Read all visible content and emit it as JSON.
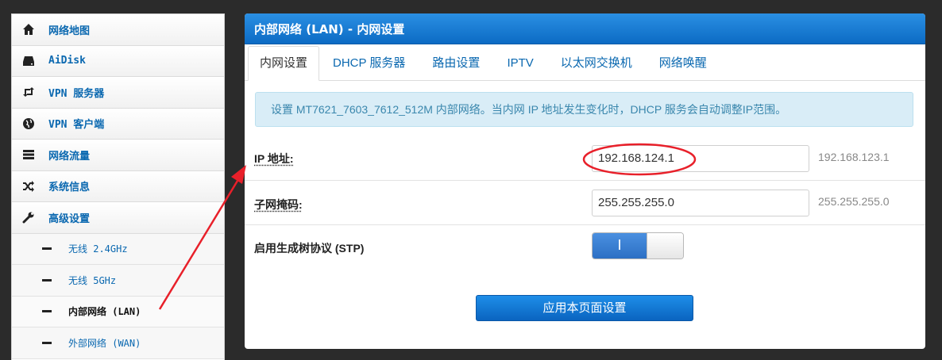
{
  "sidebar": {
    "items": [
      {
        "label": "网络地图",
        "icon": "home-icon"
      },
      {
        "label": "AiDisk",
        "icon": "hdd-icon"
      },
      {
        "label": "VPN 服务器",
        "icon": "retweet-icon"
      },
      {
        "label": "VPN 客户端",
        "icon": "globe-icon"
      },
      {
        "label": "网络流量",
        "icon": "tasks-icon"
      },
      {
        "label": "系统信息",
        "icon": "random-icon"
      },
      {
        "label": "高级设置",
        "icon": "wrench-icon"
      }
    ],
    "subitems": [
      {
        "label": "无线 2.4GHz"
      },
      {
        "label": "无线 5GHz"
      },
      {
        "label": "内部网络 (LAN)"
      },
      {
        "label": "外部网络 (WAN)"
      }
    ]
  },
  "panel": {
    "title": "内部网络 (LAN) - 内网设置",
    "tabs": [
      {
        "label": "内网设置"
      },
      {
        "label": "DHCP 服务器"
      },
      {
        "label": "路由设置"
      },
      {
        "label": "IPTV"
      },
      {
        "label": "以太网交换机"
      },
      {
        "label": "网络唤醒"
      }
    ],
    "info": "设置 MT7621_7603_7612_512M 内部网络。当内网 IP 地址发生变化时，DHCP 服务会自动调整IP范围。",
    "ip": {
      "label": "IP 地址:",
      "value": "192.168.124.1",
      "hint": "192.168.123.1"
    },
    "mask": {
      "label": "子网掩码:",
      "value": "255.255.255.0",
      "hint": "255.255.255.0"
    },
    "stp": {
      "label": "启用生成树协议 (STP)",
      "toggle_text": "I"
    },
    "apply_label": "应用本页面设置"
  },
  "colors": {
    "accent": "#0c6bc4",
    "link": "#0a68b0",
    "annotation": "#e8202a",
    "info_bg": "#d9edf7"
  }
}
